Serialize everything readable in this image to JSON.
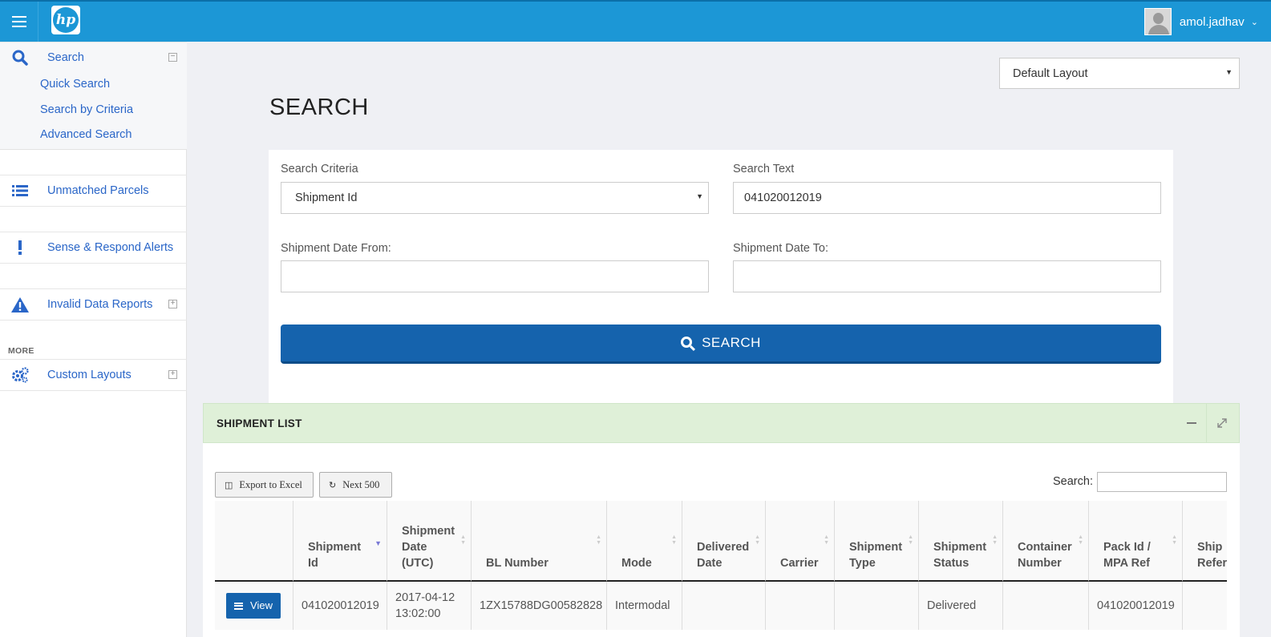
{
  "header": {
    "logo_text": "hp",
    "username": "amol.jadhav"
  },
  "sidebar": {
    "search": {
      "label": "Search",
      "subitems": [
        "Quick Search",
        "Search by Criteria",
        "Advanced Search"
      ]
    },
    "items": [
      {
        "label": "Unmatched Parcels",
        "icon": "list-icon"
      },
      {
        "label": "Sense & Respond Alerts",
        "icon": "exclamation-icon"
      },
      {
        "label": "Invalid Data Reports",
        "icon": "warning-icon"
      }
    ],
    "more_label": "MORE",
    "custom_layouts": {
      "label": "Custom Layouts",
      "icon": "gears-icon"
    }
  },
  "layout_select": {
    "value": "Default Layout"
  },
  "page_title": "SEARCH",
  "form": {
    "criteria_label": "Search Criteria",
    "criteria_value": "Shipment Id",
    "text_label": "Search Text",
    "text_value": "041020012019",
    "date_from_label": "Shipment Date From:",
    "date_from_value": "",
    "date_to_label": "Shipment Date To:",
    "date_to_value": "",
    "search_button": "SEARCH"
  },
  "shipment_list": {
    "title": "SHIPMENT LIST",
    "export_button": "Export to Excel",
    "next_button": "Next 500",
    "search_label": "Search:",
    "columns": [
      "",
      "Shipment Id",
      "Shipment Date (UTC)",
      "BL Number",
      "Mode",
      "Delivered Date",
      "Carrier",
      "Shipment Type",
      "Shipment Status",
      "Container Number",
      "Pack Id / MPA Ref",
      "Ship Refer"
    ],
    "rows": [
      {
        "action": "View",
        "shipment_id": "041020012019",
        "shipment_date": "2017-04-12 13:02:00",
        "bl_number": "1ZX15788DG00582828",
        "mode": "Intermodal",
        "delivered_date": "",
        "carrier": "",
        "shipment_type": "",
        "shipment_status": "Delivered",
        "container_number": "",
        "pack_id": "041020012019",
        "ship_ref": ""
      }
    ]
  },
  "colors": {
    "topbar": "#1c97d6",
    "primary_button": "#1563ad",
    "link": "#2a66c8",
    "list_header": "#dff0d8"
  }
}
